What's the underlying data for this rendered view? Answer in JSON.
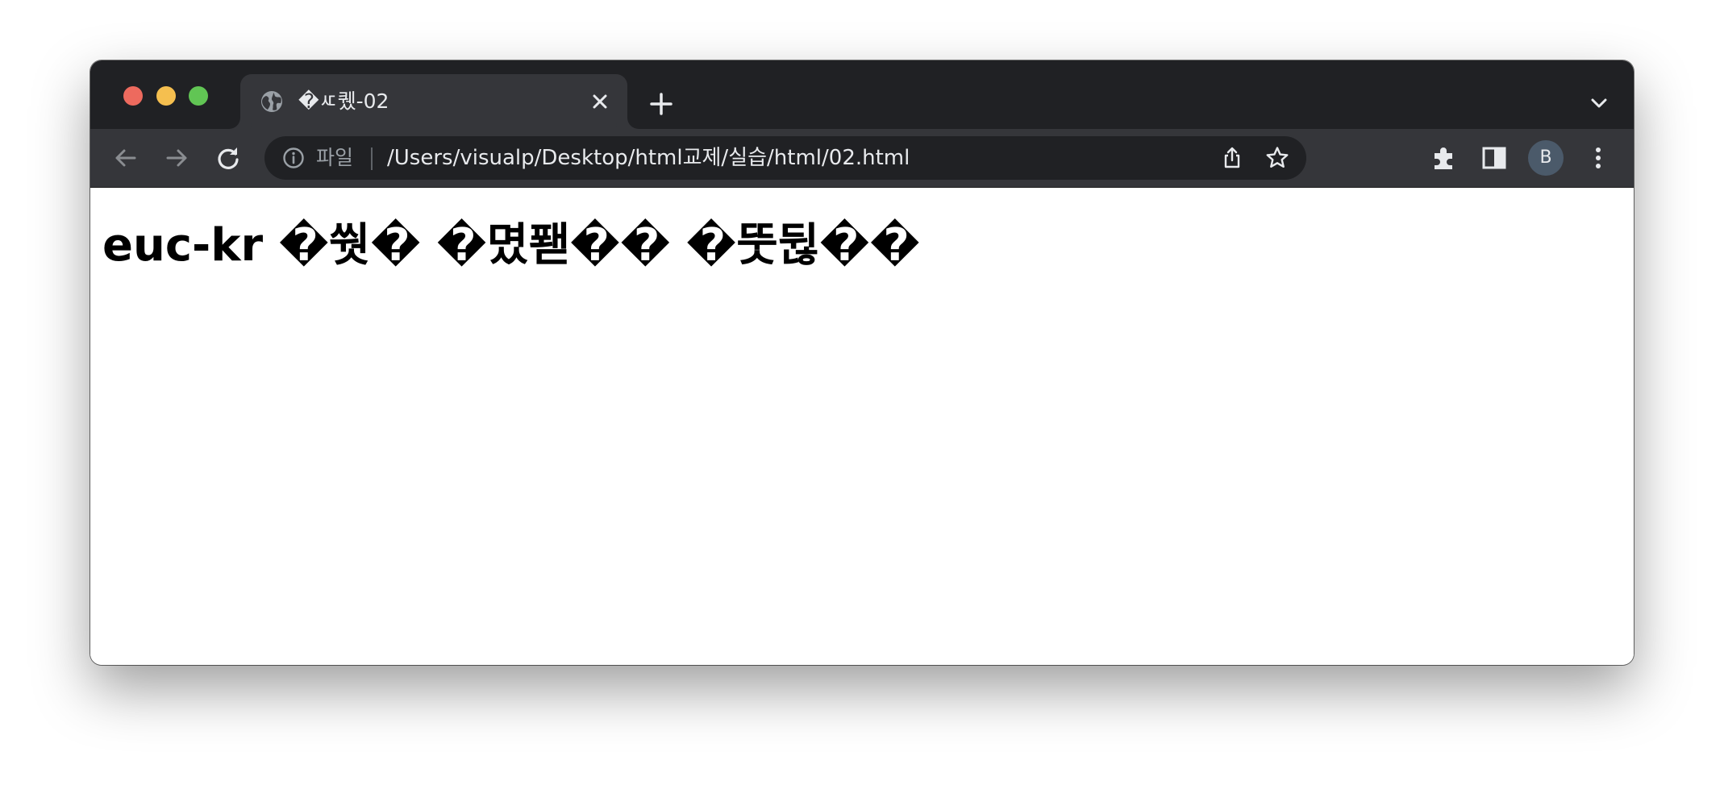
{
  "window": {
    "traffic_lights": [
      "close",
      "minimize",
      "zoom"
    ]
  },
  "tab": {
    "icon": "globe-icon",
    "title": "�ㅼ퀬-02",
    "close_icon": "close-icon"
  },
  "tabstrip": {
    "new_tab_icon": "plus-icon",
    "tab_search_icon": "chevron-down-icon"
  },
  "toolbar": {
    "back_icon": "arrow-left-icon",
    "forward_icon": "arrow-right-icon",
    "reload_icon": "reload-icon",
    "extensions_icon": "puzzle-icon",
    "side_panel_icon": "side-panel-icon",
    "menu_icon": "kebab-menu-icon"
  },
  "omnibox": {
    "info_icon": "info-icon",
    "scheme_label": "파일",
    "url": "/Users/visualp/Desktop/html교제/실습/html/02.html",
    "share_icon": "share-icon",
    "star_icon": "star-icon"
  },
  "profile": {
    "initial": "B"
  },
  "page": {
    "heading": "euc-kr �쒓� �몄퐫�� �뚯뒪��"
  },
  "colors": {
    "tabstrip_bg": "#202124",
    "toolbar_bg": "#35363a",
    "omnibox_bg": "#202124",
    "close_red": "#ed6a5e",
    "minimize_yellow": "#f5bf4f",
    "zoom_green": "#61c554",
    "avatar_bg": "#4b5a6a"
  }
}
